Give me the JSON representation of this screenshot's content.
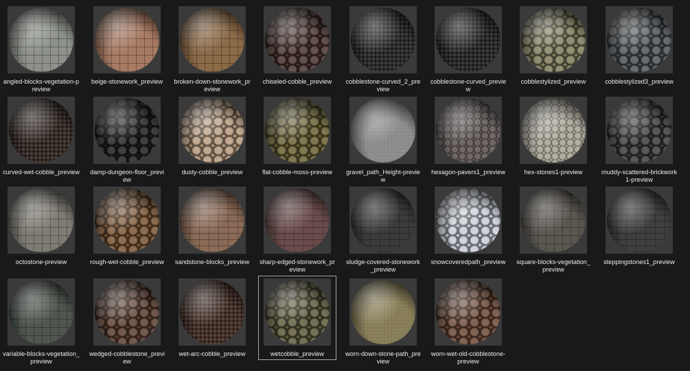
{
  "explorer": {
    "items": [
      {
        "label": "angled-blocks-vegetation-preview",
        "sphere": "#8d918a",
        "pattern": "blocks"
      },
      {
        "label": "beige-stonework_preview",
        "sphere": "#a77a63",
        "pattern": "blocks"
      },
      {
        "label": "broken-down-stonework_preview",
        "sphere": "#8c6a48",
        "pattern": "blocks"
      },
      {
        "label": "chiseled-cobble_preview",
        "sphere": "#4b3530",
        "pattern": "cobble"
      },
      {
        "label": "cobblestone-curved_2_preview",
        "sphere": "#2d2d2d",
        "pattern": "fine"
      },
      {
        "label": "cobblestone-curved_preview",
        "sphere": "#2a2a2a",
        "pattern": "fine"
      },
      {
        "label": "cobblestylized_preview",
        "sphere": "#807d5c",
        "pattern": "cobble"
      },
      {
        "label": "cobblestylized3_preview",
        "sphere": "#4f5458",
        "pattern": "cobble"
      },
      {
        "label": "curved-wet-cobble_preview",
        "sphere": "#3a2e28",
        "pattern": "fine"
      },
      {
        "label": "damp-dungeon-floor_preview",
        "sphere": "#1f1f1f",
        "pattern": "cobble"
      },
      {
        "label": "dusty-cobble_preview",
        "sphere": "#b79a7e",
        "pattern": "cobble"
      },
      {
        "label": "flat-cobble-moss-preview",
        "sphere": "#6a6234",
        "pattern": "cobble"
      },
      {
        "label": "gravel_path_Height-preview",
        "sphere": "#8a8a8c",
        "pattern": "noise"
      },
      {
        "label": "hexagon-pavers1_preview",
        "sphere": "#5f5756",
        "pattern": "hex"
      },
      {
        "label": "hex-stones1-preview",
        "sphere": "#a9a597",
        "pattern": "hex"
      },
      {
        "label": "muddy-scattered-brickwork1-preview",
        "sphere": "#3d3d40",
        "pattern": "cobble"
      },
      {
        "label": "octostone-preview",
        "sphere": "#7f7c74",
        "pattern": "blocks"
      },
      {
        "label": "rough-wet-cobble_preview",
        "sphere": "#7a5534",
        "pattern": "cobble"
      },
      {
        "label": "sandstone-blocks_preview",
        "sphere": "#8b6b57",
        "pattern": "brick"
      },
      {
        "label": "sharp-edged-stonework_preview",
        "sphere": "#6b4c4c",
        "pattern": "brick"
      },
      {
        "label": "sludge-covered-stonework_preview",
        "sphere": "#3b3b3e",
        "pattern": "brick"
      },
      {
        "label": "snowcoveredpath_preview",
        "sphere": "#c8cdd6",
        "pattern": "cobble"
      },
      {
        "label": "square-blocks-vegetation_preview",
        "sphere": "#5a5650",
        "pattern": "blocks"
      },
      {
        "label": "steppingstones1_preview",
        "sphere": "#3f3f3f",
        "pattern": "brick"
      },
      {
        "label": "variable-blocks-vegetation_preview",
        "sphere": "#4f5750",
        "pattern": "blocks"
      },
      {
        "label": "wedged-cobblestone_preview",
        "sphere": "#5c3f31",
        "pattern": "cobble"
      },
      {
        "label": "wet-arc-cobble_preview",
        "sphere": "#4a3329",
        "pattern": "fine"
      },
      {
        "label": "wetcobble_preview",
        "sphere": "#5f5b3d",
        "pattern": "cobble",
        "selected": true
      },
      {
        "label": "worn-down-stone-path_preview",
        "sphere": "#857b55",
        "pattern": "noise"
      },
      {
        "label": "worn-wet-old-cobblestone-preview",
        "sphere": "#6e4a39",
        "pattern": "cobble"
      }
    ]
  }
}
